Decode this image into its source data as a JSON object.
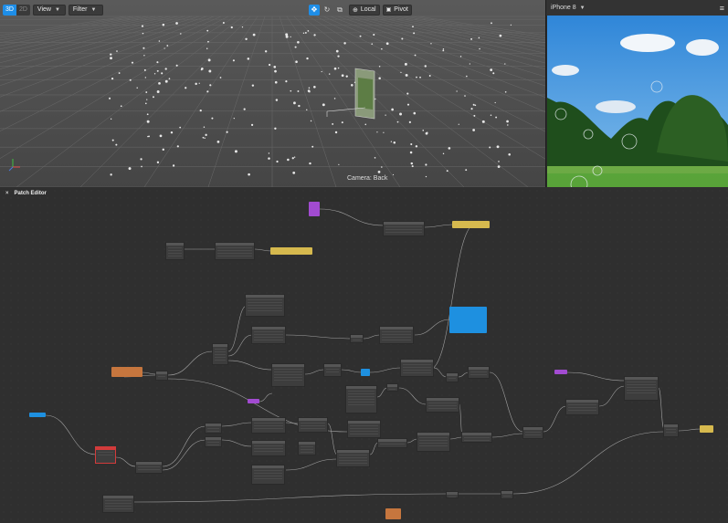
{
  "toolbar": {
    "mode_3d": "3D",
    "mode_2d": "2D",
    "view_label": "View",
    "filter_label": "Filter",
    "local_label": "Local",
    "pivot_label": "Pivot"
  },
  "viewport": {
    "camera_label": "Camera: Back"
  },
  "preview": {
    "device_label": "iPhone 8",
    "menu_icon": "hamburger-icon",
    "footer_icons": [
      "screenshot-icon",
      "rotate-icon"
    ]
  },
  "patch_editor": {
    "title": "Patch Editor",
    "close_glyph": "×"
  },
  "colors": {
    "accent": "#1e8ee8",
    "patch_yellow": "#d6b94e",
    "patch_orange": "#c6763e",
    "patch_purple": "#a24bd1",
    "patch_blue": "#1e90e0",
    "patch_red": "#d23b3b"
  }
}
